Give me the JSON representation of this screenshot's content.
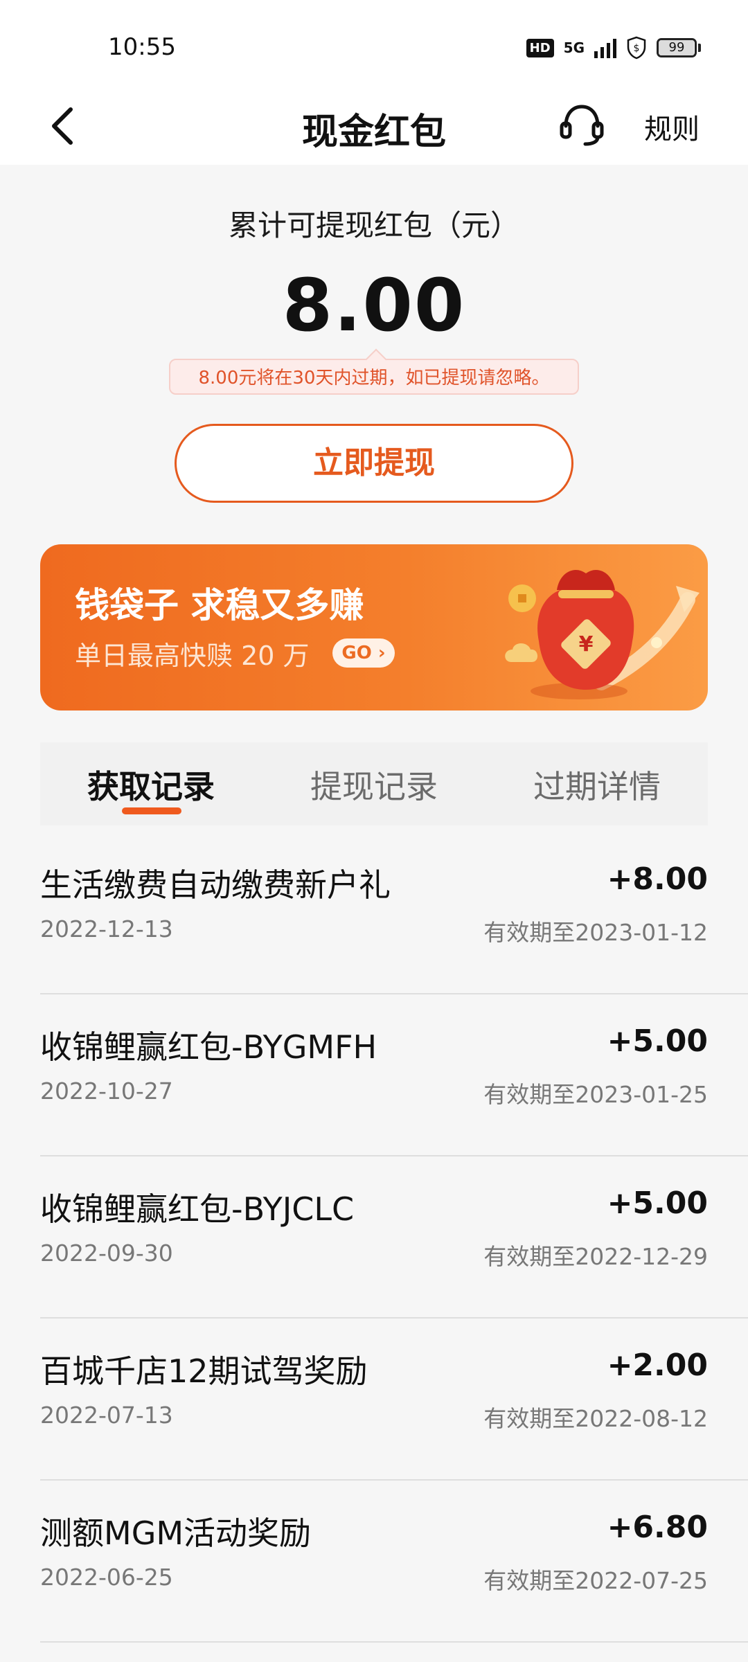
{
  "status_bar": {
    "time": "10:55",
    "hd_label": "HD",
    "network_label": "5G",
    "battery_level": "99"
  },
  "nav": {
    "title": "现金红包",
    "rules_label": "规则",
    "icons": [
      "chevron-left-icon",
      "headset-icon"
    ]
  },
  "balance": {
    "label": "累计可提现红包（元）",
    "amount": "8.00",
    "expire_tip": "8.00元将在30天内过期，如已提现请忽略。",
    "withdraw_button": "立即提现"
  },
  "banner": {
    "title": "钱袋子 求稳又多赚",
    "subtitle": "单日最高快赎 20 万",
    "go_label": "GO ›",
    "colors": {
      "start": "#ef6a1f",
      "end": "#fb9c45"
    },
    "icon": "money-bag-icon"
  },
  "tabs": [
    {
      "label": "获取记录",
      "active": true
    },
    {
      "label": "提现记录",
      "active": false
    },
    {
      "label": "过期详情",
      "active": false
    }
  ],
  "records": [
    {
      "title": "生活缴费自动缴费新户礼",
      "amount": "+8.00",
      "date": "2022-12-13",
      "expiry": "有效期至2023-01-12"
    },
    {
      "title": "收锦鲤赢红包-BYGMFH",
      "amount": "+5.00",
      "date": "2022-10-27",
      "expiry": "有效期至2023-01-25"
    },
    {
      "title": "收锦鲤赢红包-BYJCLC",
      "amount": "+5.00",
      "date": "2022-09-30",
      "expiry": "有效期至2022-12-29"
    },
    {
      "title": "百城千店12期试驾奖励",
      "amount": "+2.00",
      "date": "2022-07-13",
      "expiry": "有效期至2022-08-12"
    },
    {
      "title": "测额MGM活动奖励",
      "amount": "+6.80",
      "date": "2022-06-25",
      "expiry": "有效期至2022-07-25"
    }
  ],
  "theme": {
    "accent": "#e55a1e",
    "tip_bg": "#fdecea"
  }
}
